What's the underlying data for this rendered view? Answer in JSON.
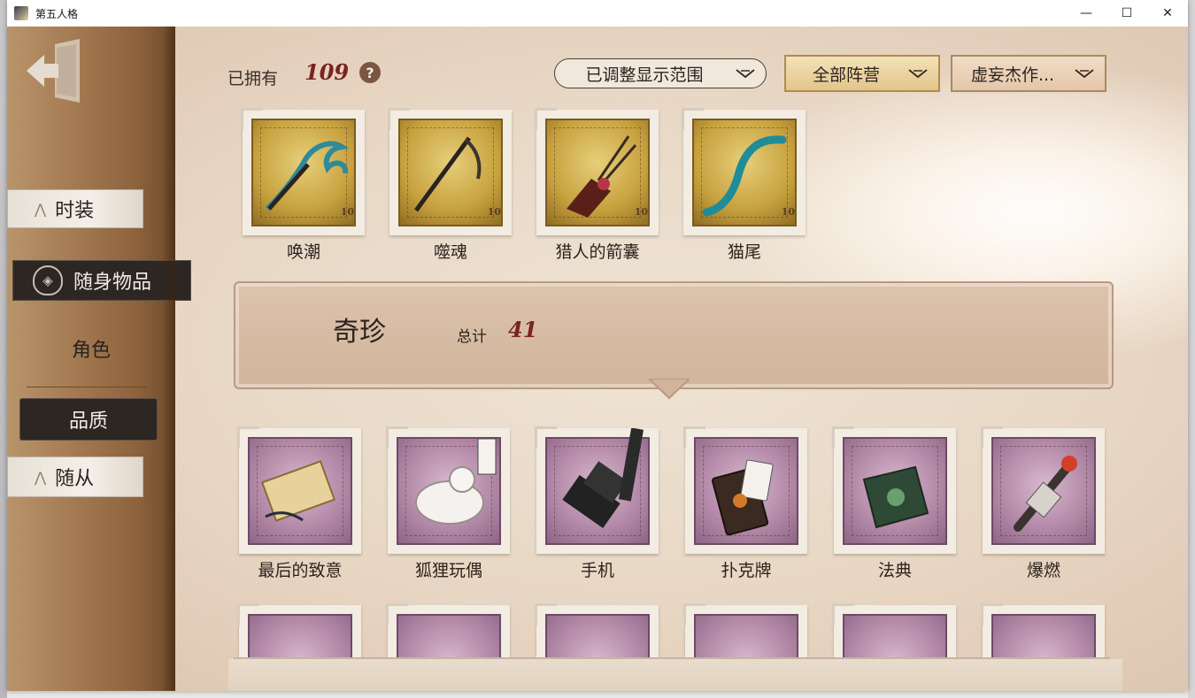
{
  "window": {
    "title": "第五人格",
    "controls": {
      "minimize": "—",
      "maximize": "☐",
      "close": "✕"
    }
  },
  "sidebar": {
    "tabs": [
      {
        "label": "时装",
        "state": "normal"
      },
      {
        "label": "随身物品",
        "state": "selected"
      },
      {
        "label": "角色",
        "state": "normal"
      },
      {
        "label": "品质",
        "state": "selected"
      },
      {
        "label": "随从",
        "state": "normal"
      }
    ]
  },
  "header": {
    "owned_label": "已拥有",
    "owned_count": "109",
    "help": "?",
    "filters": {
      "range": "已调整显示范围",
      "faction": "全部阵营",
      "author": "虚妄杰作..."
    }
  },
  "top_row": {
    "items": [
      {
        "name": "唤潮",
        "stamp_value": "10"
      },
      {
        "name": "噬魂",
        "stamp_value": "10"
      },
      {
        "name": "猎人的箭囊",
        "stamp_value": "10"
      },
      {
        "name": "猫尾",
        "stamp_value": "10"
      }
    ]
  },
  "category": {
    "title": "奇珍",
    "total_label": "总计",
    "total_value": "41"
  },
  "grid_items": [
    {
      "name": "最后的致意"
    },
    {
      "name": "狐狸玩偶"
    },
    {
      "name": "手机"
    },
    {
      "name": "扑克牌"
    },
    {
      "name": "法典"
    },
    {
      "name": "爆燃"
    }
  ],
  "colors": {
    "accent_red": "#7a2320",
    "gold_stamp": "#c7a13e",
    "purple_stamp": "#b48aa8",
    "sidebar_brown": "#a47a52"
  }
}
